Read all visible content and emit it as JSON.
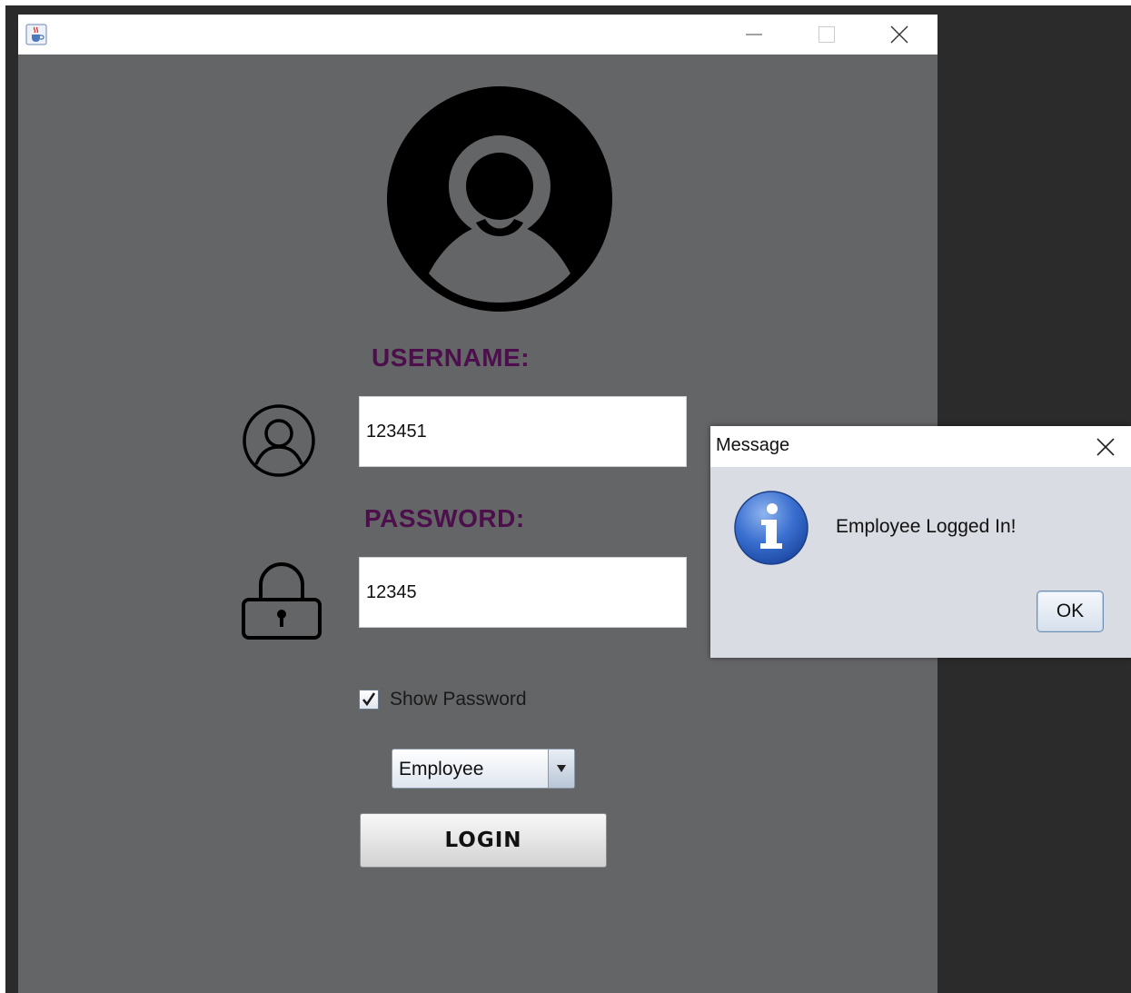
{
  "login_window": {
    "title": "",
    "username": {
      "label": "USERNAME:",
      "value": "123451"
    },
    "password": {
      "label": "PASSWORD:",
      "value": "12345"
    },
    "show_password": {
      "label": "Show Password",
      "checked": true
    },
    "role_select": {
      "selected": "Employee"
    },
    "login_button_label": "LOGIN",
    "icons": {
      "app": "java-cup-icon",
      "avatar": "user-avatar-icon",
      "username": "user-circle-icon",
      "password": "padlock-icon",
      "minimize": "minimize-icon",
      "maximize": "maximize-icon",
      "close": "close-icon"
    }
  },
  "message_dialog": {
    "title": "Message",
    "message": "Employee Logged In!",
    "ok_label": "OK",
    "icon": "info-icon"
  },
  "colors": {
    "window_background": "#646567",
    "label_color": "#4c0f4c",
    "desktop_dark": "#2b2b2b",
    "dialog_background": "#d9dce3",
    "info_icon_blue": "#2f63c8"
  }
}
